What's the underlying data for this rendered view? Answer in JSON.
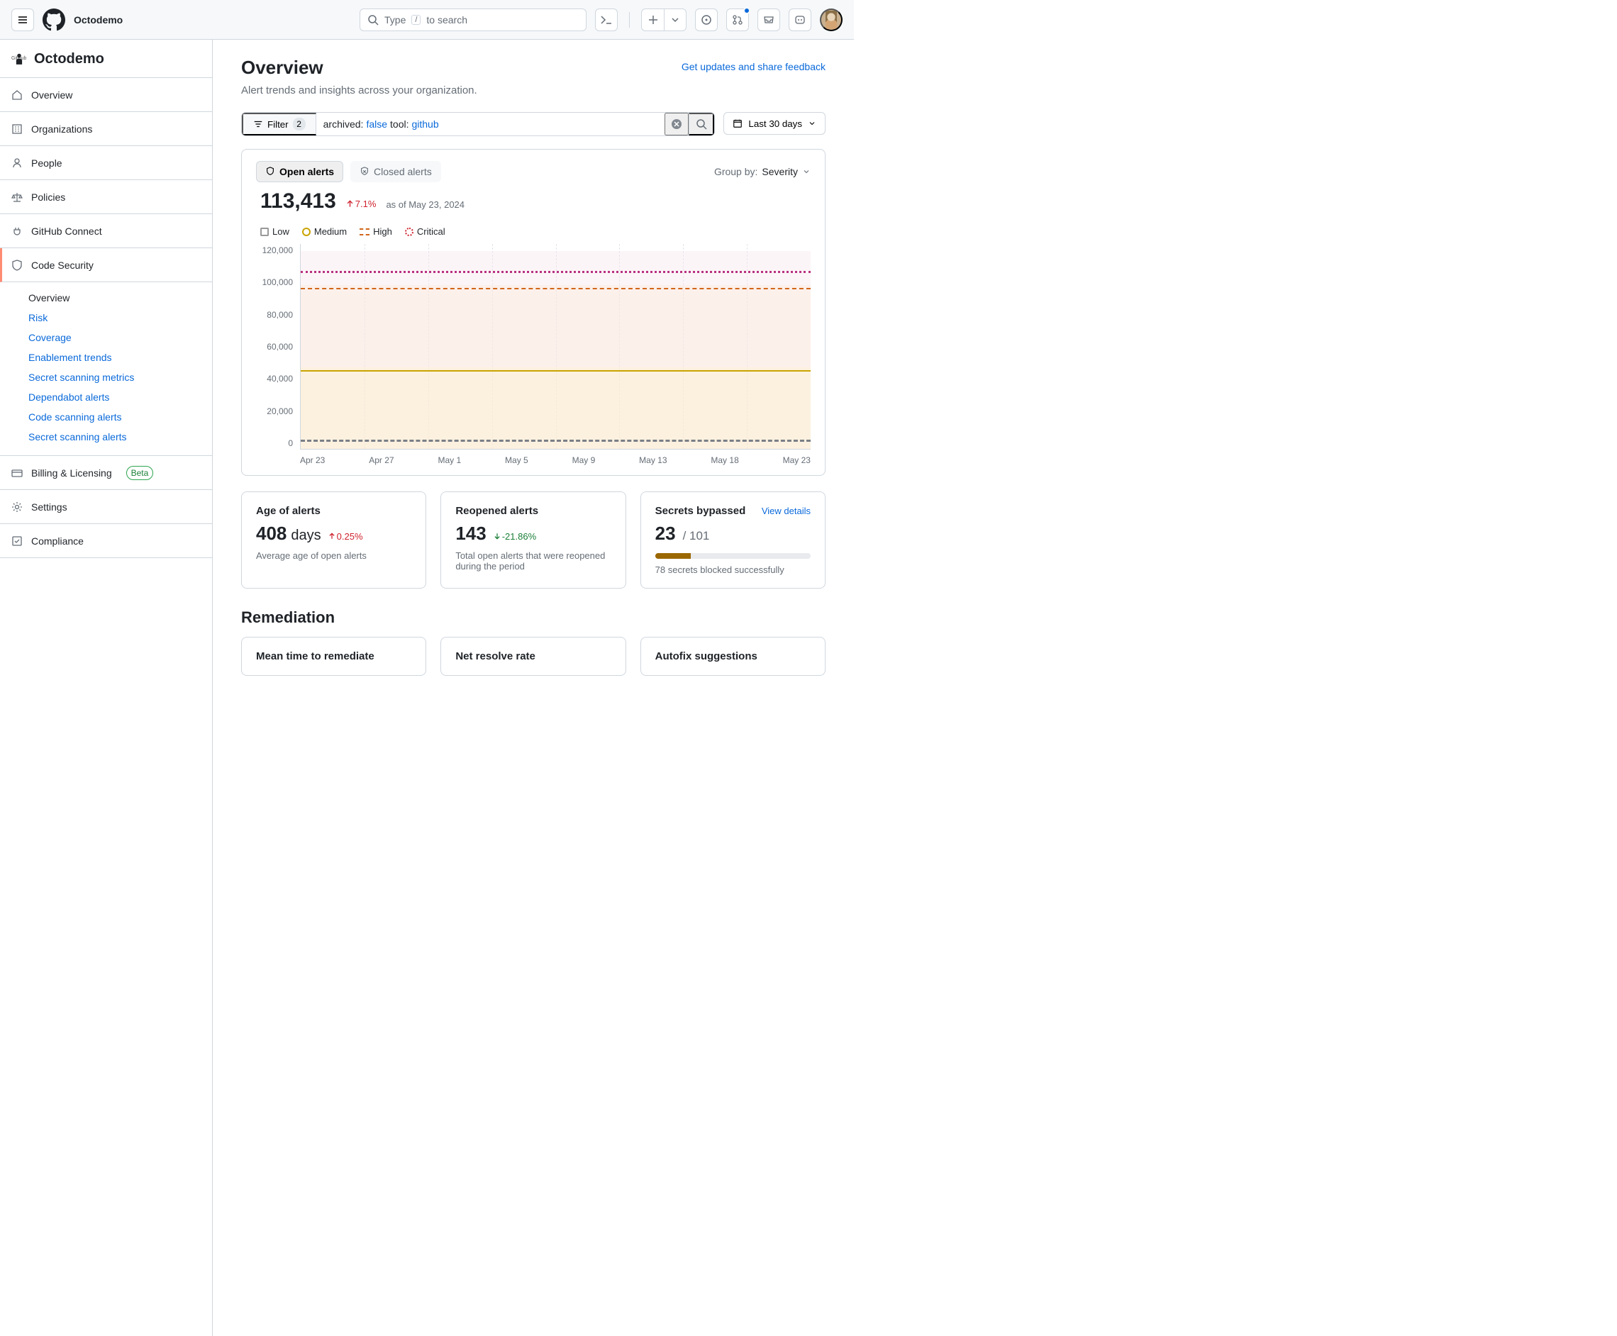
{
  "top": {
    "repo": "Octodemo",
    "search_placeholder_pre": "Type",
    "search_placeholder_post": "to search",
    "slash": "/"
  },
  "sidebar": {
    "org": "Octodemo",
    "items": {
      "overview": "Overview",
      "organizations": "Organizations",
      "people": "People",
      "policies": "Policies",
      "connect": "GitHub Connect",
      "security": "Code Security",
      "billing": "Billing & Licensing",
      "billing_badge": "Beta",
      "settings": "Settings",
      "compliance": "Compliance"
    },
    "sub": {
      "overview": "Overview",
      "risk": "Risk",
      "coverage": "Coverage",
      "enablement": "Enablement trends",
      "secret_metrics": "Secret scanning metrics",
      "dependabot": "Dependabot alerts",
      "code_scanning": "Code scanning alerts",
      "secret_alerts": "Secret scanning alerts"
    }
  },
  "page": {
    "title": "Overview",
    "subtitle": "Alert trends and insights across your organization.",
    "feedback": "Get updates and share feedback"
  },
  "filter": {
    "label": "Filter",
    "count": "2",
    "q_k1": "archived:",
    "q_v1": "false",
    "q_k2": " tool:",
    "q_v2": "github",
    "date": "Last 30 days"
  },
  "panel": {
    "tab_open": "Open alerts",
    "tab_closed": "Closed alerts",
    "groupby_label": "Group by:",
    "groupby_value": "Severity",
    "total": "113,413",
    "trend_pct": "7.1%",
    "asof": "as of May 23, 2024",
    "legend": {
      "low": "Low",
      "medium": "Medium",
      "high": "High",
      "critical": "Critical"
    }
  },
  "chart_data": {
    "type": "area",
    "title": "Open alerts",
    "xlabel": "",
    "ylabel": "",
    "ylim": [
      0,
      120000
    ],
    "y_ticks": [
      "120,000",
      "100,000",
      "80,000",
      "60,000",
      "40,000",
      "20,000",
      "0"
    ],
    "x_ticks": [
      "Apr 23",
      "Apr 27",
      "May 1",
      "May 5",
      "May 9",
      "May 13",
      "May 18",
      "May 23"
    ],
    "categories": [
      "Apr 23",
      "Apr 27",
      "May 1",
      "May 5",
      "May 9",
      "May 13",
      "May 18",
      "May 23"
    ],
    "series": [
      {
        "name": "Low",
        "values": [
          4000,
          4000,
          4000,
          4000,
          4000,
          4000,
          4000,
          4000
        ]
      },
      {
        "name": "Medium",
        "values": [
          48000,
          48000,
          48000,
          48000,
          48000,
          48000,
          49000,
          52000
        ]
      },
      {
        "name": "High",
        "values": [
          93000,
          93000,
          93000,
          93000,
          93000,
          93000,
          95000,
          99000
        ]
      },
      {
        "name": "Critical",
        "values": [
          106000,
          106000,
          106000,
          106000,
          106000,
          106000,
          108000,
          113000
        ]
      }
    ]
  },
  "cards": {
    "age": {
      "title": "Age of alerts",
      "value": "408",
      "unit": "days",
      "trend": "0.25%",
      "desc": "Average age of open alerts"
    },
    "reopened": {
      "title": "Reopened alerts",
      "value": "143",
      "trend": "-21.86%",
      "desc": "Total open alerts that were reopened during the period"
    },
    "bypassed": {
      "title": "Secrets bypassed",
      "link": "View details",
      "value": "23",
      "total": "/ 101",
      "desc": "78 secrets blocked successfully"
    }
  },
  "remediation": {
    "heading": "Remediation",
    "mtt": "Mean time to remediate",
    "net": "Net resolve rate",
    "autofix": "Autofix suggestions"
  }
}
